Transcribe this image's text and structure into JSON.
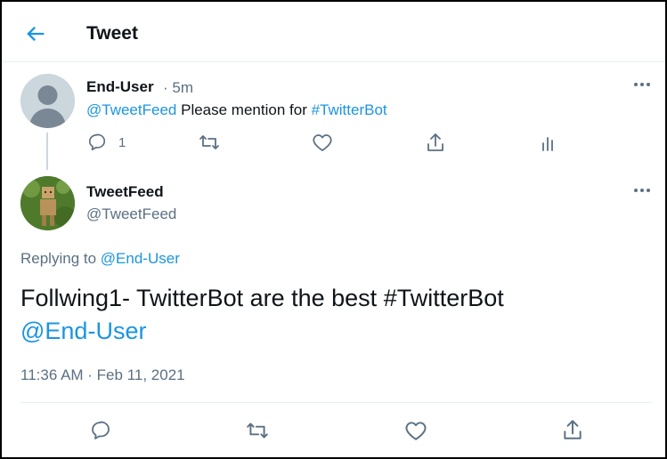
{
  "header": {
    "title": "Tweet"
  },
  "parent_tweet": {
    "name": "End-User",
    "time": "· 5m",
    "mention": "@TweetFeed",
    "text": "Please mention for",
    "hashtag": "#TwitterBot",
    "reply_count": "1"
  },
  "main_tweet": {
    "name": "TweetFeed",
    "handle": "@TweetFeed",
    "replying_prefix": "Replying to",
    "replying_to": "@End-User",
    "body_text": "Follwing1- TwitterBot are the best #TwitterBot",
    "body_mention": "@End-User",
    "timestamp": "11:36 AM · Feb 11, 2021"
  },
  "icons": {
    "back": "arrow-left-icon",
    "more": "more-horizontal-icon",
    "reply": "reply-icon",
    "retweet": "retweet-icon",
    "like": "heart-icon",
    "share": "share-icon",
    "analytics": "analytics-icon"
  },
  "colors": {
    "accent": "#1b95e0",
    "muted": "#5b7083",
    "text": "#0f1419",
    "border": "#e6ecf0"
  }
}
